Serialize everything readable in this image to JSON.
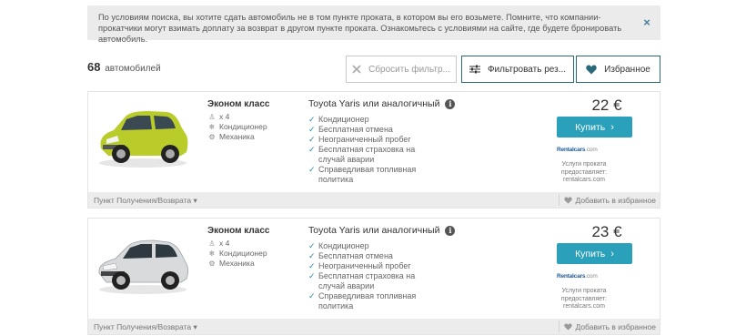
{
  "notice": {
    "text": "По условиям поиска, вы хотите сдать автомобиль не в том пункте проката, в котором вы его возьмете. Помните, что компании-прокатчики могут взимать доплату за возврат в другом пункте проката. Ознакомьтесь с условиями на сайте, где будете бронировать автомобиль.",
    "close_glyph": "×"
  },
  "results": {
    "count": "68",
    "count_label": "автомобилей"
  },
  "toolbar": {
    "reset_label": "Сбросить фильтр...",
    "filter_label": "Фильтровать рез...",
    "favorites_label": "Избранное"
  },
  "cards": [
    {
      "class_name": "Эконом класс",
      "seats": "x 4",
      "ac": "Кондиционер",
      "transmission": "Механика",
      "model": "Toyota Yaris или аналогичный",
      "features": [
        "Кондиционер",
        "Бесплатная отмена",
        "Неограниченный пробег",
        "Бесплатная страховка на случай аварии",
        "Справедливая топливная политика"
      ],
      "price": "22 €",
      "buy_label": "Купить",
      "provider_logo": "Rentalcars",
      "provider_logo_suffix": ".com",
      "provided_by": "Услуги проката предоставляет: rentalcars.com",
      "pickup_label": "Пункт Получения/Возврата",
      "favorite_label": "Добавить в избранное",
      "car_color": "#b9cc2a"
    },
    {
      "class_name": "Эконом класс",
      "seats": "x 4",
      "ac": "Кондиционер",
      "transmission": "Механика",
      "model": "Toyota Yaris или аналогичный",
      "features": [
        "Кондиционер",
        "Бесплатная отмена",
        "Неограниченный пробег",
        "Бесплатная страховка на случай аварии",
        "Справедливая топливная политика"
      ],
      "price": "23 €",
      "buy_label": "Купить",
      "provider_logo": "Rentalcars",
      "provider_logo_suffix": ".com",
      "provided_by": "Услуги проката предоставляет: rentalcars.com",
      "pickup_label": "Пункт Получения/Возврата",
      "favorite_label": "Добавить в избранное",
      "car_color": "#d8dadc"
    }
  ],
  "colors": {
    "accent": "#2ba0bb",
    "border_dark": "#2a6a78",
    "check": "#2c8bb0"
  }
}
